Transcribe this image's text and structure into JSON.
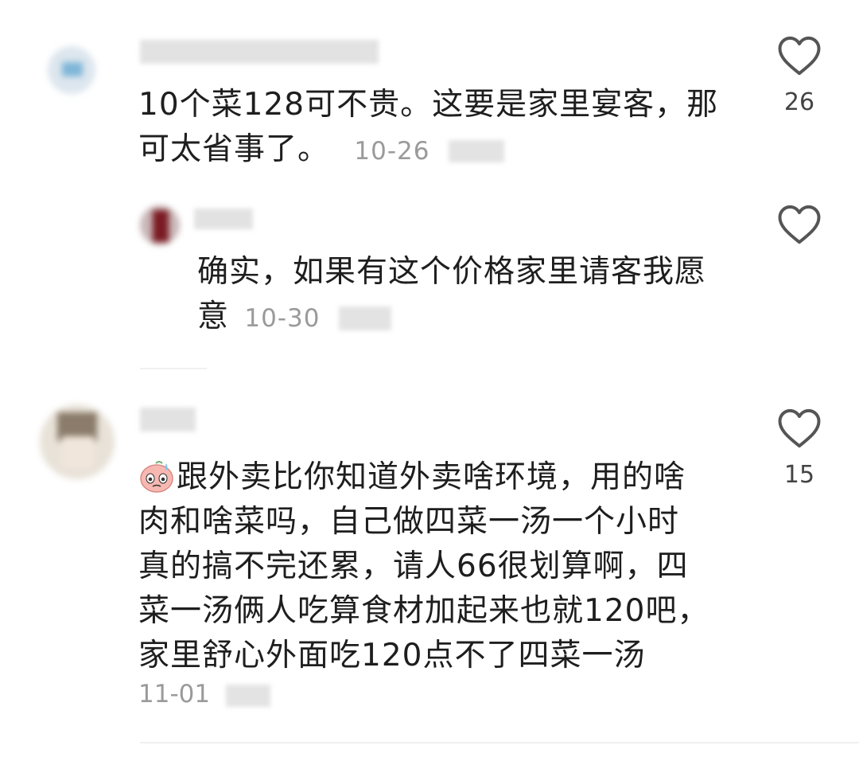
{
  "comments": [
    {
      "text_line1": "10个菜128可不贵。这要是家里宴客，那",
      "text_line2": "可太省事了。",
      "date": "10-26",
      "likes": "26",
      "reply": {
        "text_line1": "确实，如果有这个价格家里请客我愿",
        "text_line2": "意",
        "date": "10-30"
      }
    },
    {
      "text_lines": [
        "跟外卖比你知道外卖啥环境，用的啥",
        "肉和啥菜吗，自己做四菜一汤一个小时",
        "真的搞不完还累，请人66很划算啊，四",
        "菜一汤俩人吃算食材加起来也就120吧，",
        "家里舒心外面吃120点不了四菜一汤"
      ],
      "date": "11-01",
      "likes": "15",
      "emoji": "sweat-face-emoji"
    }
  ],
  "icons": {
    "like": "heart-outline-icon"
  },
  "colors": {
    "text": "#1e1e1e",
    "meta": "#9a9a9a",
    "icon": "#555555"
  }
}
